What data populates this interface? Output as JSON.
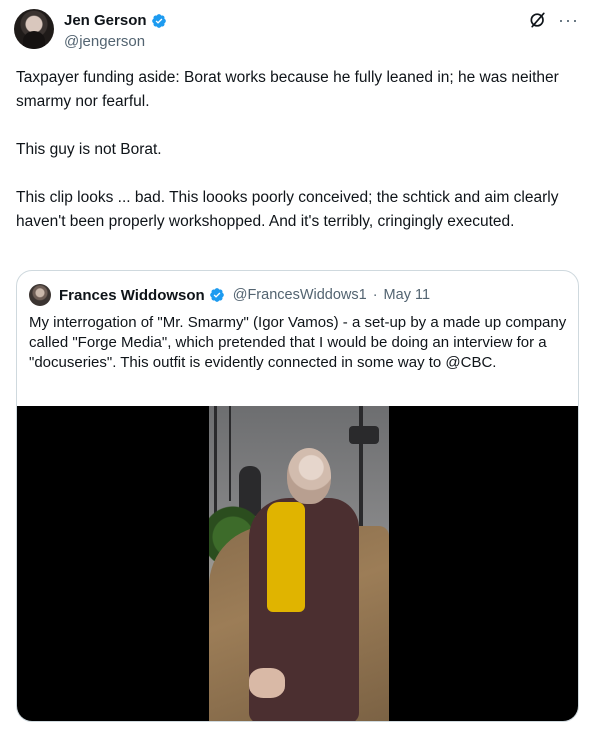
{
  "author": {
    "display_name": "Jen Gerson",
    "handle": "@jengerson"
  },
  "tweet": {
    "paragraphs": [
      "Taxpayer funding aside: Borat works because he fully leaned in; he was neither smarmy nor fearful.",
      "This guy is not Borat.",
      "This clip looks ... bad. This loooks poorly conceived; the schtick and aim clearly haven't been properly workshopped. And it's terribly, cringingly executed."
    ]
  },
  "quote": {
    "display_name": "Frances Widdowson",
    "handle": "@FrancesWiddows1",
    "separator": "·",
    "date": "May 11",
    "text": "My interrogation of \"Mr. Smarmy\" (Igor Vamos) - a set-up by a made up company called \"Forge Media\", which pretended that I would be doing an interview for a \"docuseries\".  This outfit is evidently connected in some way to @CBC."
  },
  "icons": {
    "verified": "verified-badge-icon",
    "grok": "grok-icon",
    "more": "more-icon"
  },
  "colors": {
    "verified_blue": "#1d9bf0",
    "secondary_text": "#536471",
    "border": "#cfd9de"
  }
}
